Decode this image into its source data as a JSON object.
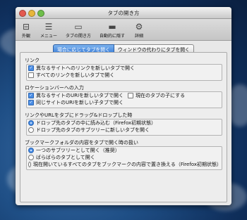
{
  "window": {
    "title": "タブの開き方"
  },
  "toolbar": {
    "items": [
      {
        "label": "外観",
        "icon": "toggle-switch-icon"
      },
      {
        "label": "メニュー",
        "icon": "menu-icon"
      },
      {
        "label": "タブの開き方",
        "icon": "tab-open-icon"
      },
      {
        "label": "自動的に隠す",
        "icon": "auto-hide-icon"
      },
      {
        "label": "詳細",
        "icon": "gear-icon"
      }
    ]
  },
  "tabs": [
    {
      "label": "場合に応じてタブを開く",
      "active": true
    },
    {
      "label": "ウィンドウの代わりにタブを開く",
      "active": false
    }
  ],
  "sections": {
    "link": {
      "title": "リンク",
      "options": [
        {
          "label": "異なるサイトへのリンクを新しいタブで開く",
          "checked": true
        },
        {
          "label": "すべてのリンクを新しいタブで開く",
          "checked": false
        }
      ]
    },
    "location": {
      "title": "ロケーションバーへの入力",
      "options": [
        {
          "label": "異なるサイトのURIを新しいタブで開く",
          "checked": true
        },
        {
          "label": "現在のタブの子にする",
          "checked": false
        },
        {
          "label": "同じサイトのURIを新しい子タブで開く",
          "checked": true
        }
      ]
    },
    "drag": {
      "title": "リンクやURLをタブにドラッグ&ドロップした時",
      "options": [
        {
          "label": "ドロップ先のタブの中に読み込む（Firefox初期状態）",
          "checked": true
        },
        {
          "label": "ドロップ先のタブのサブツリーに新しいタブを開く",
          "checked": false
        }
      ]
    },
    "bookmark": {
      "title": "ブックマークフォルダの内容をタブで開く時の扱い",
      "options": [
        {
          "label": "一つのサブツリーとして開く（推奨）",
          "checked": true
        },
        {
          "label": "ばらばらのタブとして開く",
          "checked": false
        },
        {
          "label": "現在開いているすべてのタブをブックマークの内容で置き換える（Firefox初期状態）",
          "checked": false
        }
      ]
    }
  },
  "colors": {
    "accent": "#3a7ed9",
    "desktop": "#1f4f86"
  }
}
